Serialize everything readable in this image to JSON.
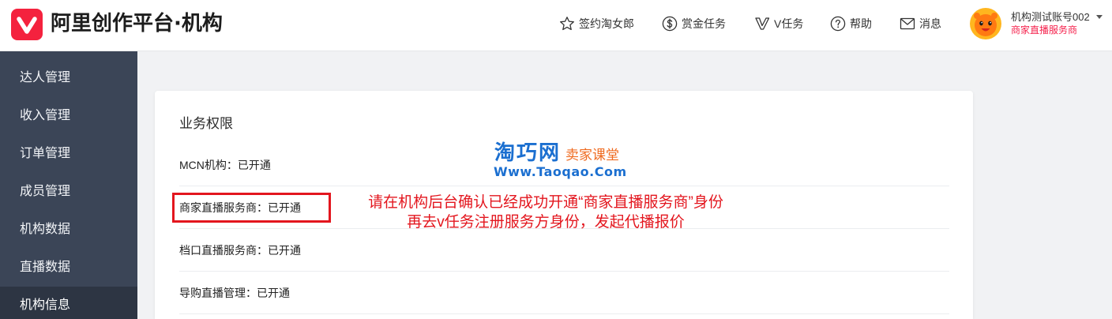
{
  "header": {
    "title": "阿里创作平台·机构",
    "logo_icon": "platform-logo-icon",
    "nav": [
      {
        "icon": "star-icon",
        "label": "签约淘女郎"
      },
      {
        "icon": "dollar-circle-icon",
        "label": "赏金任务"
      },
      {
        "icon": "v-task-icon",
        "label": "V任务"
      },
      {
        "icon": "help-circle-icon",
        "label": "帮助"
      },
      {
        "icon": "envelope-icon",
        "label": "消息"
      }
    ],
    "account": {
      "name": "机构测试账号002",
      "role": "商家直播服务商",
      "dropdown_icon": "caret-down-icon"
    }
  },
  "sidebar": {
    "items": [
      {
        "label": "达人管理",
        "active": false
      },
      {
        "label": "收入管理",
        "active": false
      },
      {
        "label": "订单管理",
        "active": false
      },
      {
        "label": "成员管理",
        "active": false
      },
      {
        "label": "机构数据",
        "active": false
      },
      {
        "label": "直播数据",
        "active": false
      },
      {
        "label": "机构信息",
        "active": true
      }
    ]
  },
  "permissions": {
    "title": "业务权限",
    "rows": [
      {
        "name": "MCN机构：",
        "status": "已开通"
      },
      {
        "name": "商家直播服务商：",
        "status": "已开通",
        "highlighted": true
      },
      {
        "name": "档口直播服务商：",
        "status": "已开通"
      },
      {
        "name": "导购直播管理：",
        "status": "已开通"
      }
    ]
  },
  "annotation": {
    "lines": [
      "请在机构后台确认已经成功开通“商家直播服务商”身份",
      "再去v任务注册服务方身份，发起代播报价"
    ]
  },
  "watermark": {
    "brand": "淘巧网",
    "tagline": "卖家课堂",
    "url": "Www.Taoqao.Com"
  },
  "colors": {
    "brand_red": "#f4223e",
    "sidebar_bg": "#3b4557",
    "sidebar_active_bg": "#2d3543",
    "annotation_red": "#e3161e",
    "role_text": "#f5224d",
    "watermark_blue": "#1b6fd0",
    "watermark_orange": "#ef6a1f",
    "page_bg": "#f1f2f4"
  }
}
